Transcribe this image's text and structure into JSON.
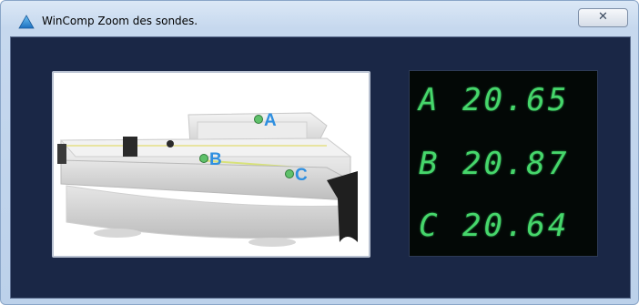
{
  "window": {
    "title": "WinComp Zoom des sondes.",
    "close_glyph": "✕"
  },
  "probes": [
    {
      "label": "A",
      "value": "20.65"
    },
    {
      "label": "B",
      "value": "20.87"
    },
    {
      "label": "C",
      "value": "20.64"
    }
  ],
  "colors": {
    "panel_bg": "#1a2746",
    "display_bg": "#030806",
    "digit_green": "#46d66b",
    "probe_marker": "#5fc16a",
    "probe_letter": "#2f8fe0"
  },
  "icons": {
    "app": "blue-triangle-icon",
    "close": "close-icon"
  }
}
